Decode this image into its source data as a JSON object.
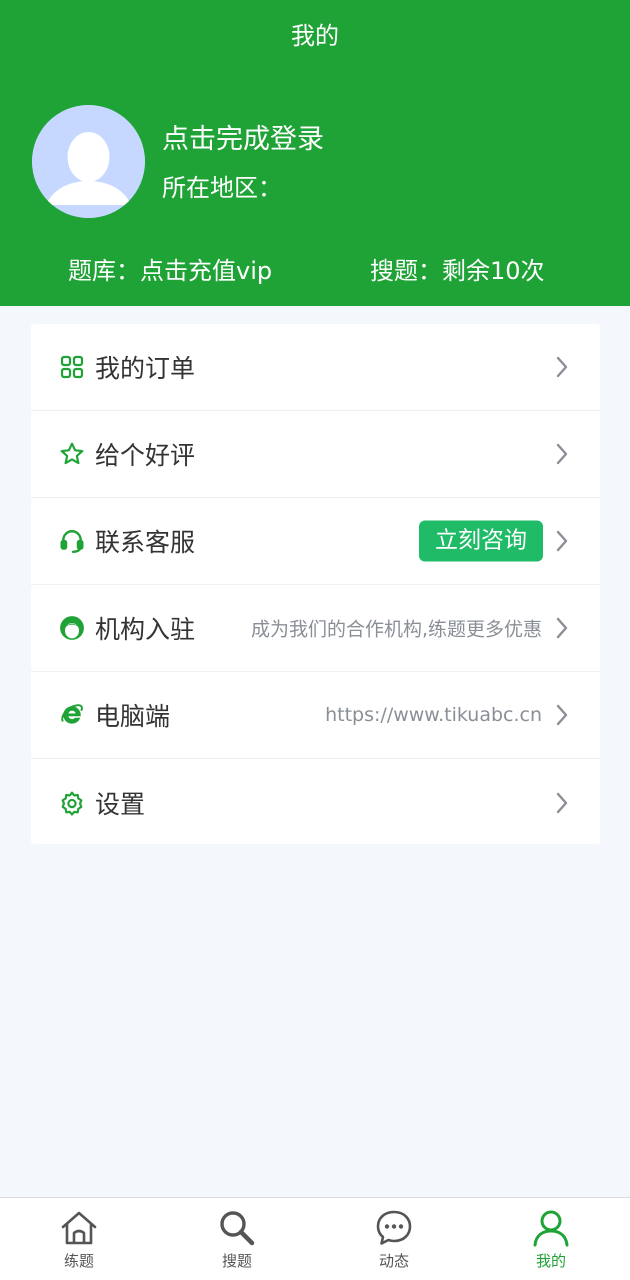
{
  "header": {
    "title": "我的",
    "login_text": "点击完成登录",
    "region_label": "所在地区：",
    "question_bank": "题库：点击充值vip",
    "search_quota": "搜题：剩余10次"
  },
  "colors": {
    "brand_green": "#1fa337",
    "consult_button": "#1fbb67",
    "avatar_bg": "#c6d8ff",
    "page_bg": "#f4f7fc"
  },
  "menu": {
    "orders": {
      "label": "我的订单",
      "icon": "grid-icon"
    },
    "review": {
      "label": "给个好评",
      "icon": "star-icon"
    },
    "support": {
      "label": "联系客服",
      "icon": "headset-icon",
      "button": "立刻咨询"
    },
    "institution": {
      "label": "机构入驻",
      "icon": "person-icon",
      "hint": "成为我们的合作机构,练题更多优惠"
    },
    "desktop": {
      "label": "电脑端",
      "icon": "ie-icon",
      "hint": "https://www.tikuabc.cn"
    },
    "settings": {
      "label": "设置",
      "icon": "gear-icon"
    }
  },
  "tabs": {
    "practice": {
      "label": "练题",
      "icon": "home-icon"
    },
    "search": {
      "label": "搜题",
      "icon": "search-icon"
    },
    "feed": {
      "label": "动态",
      "icon": "chat-icon"
    },
    "me": {
      "label": "我的",
      "icon": "user-icon",
      "active": true
    }
  }
}
